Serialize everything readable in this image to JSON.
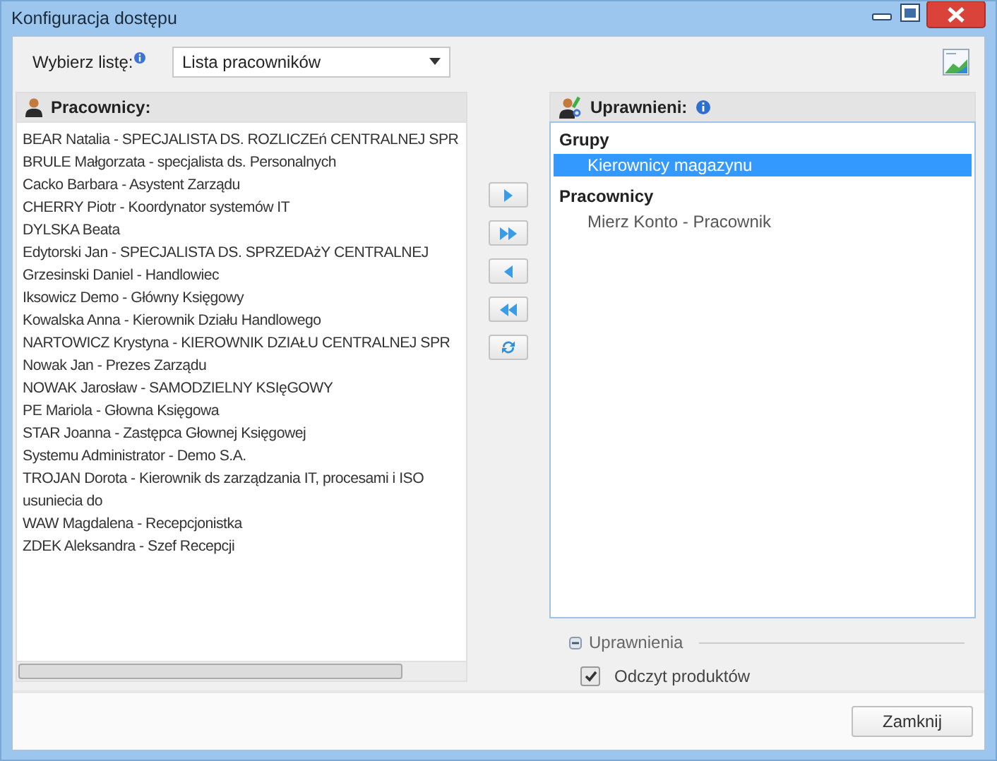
{
  "window": {
    "title": "Konfiguracja dostępu"
  },
  "list_picker": {
    "label": "Wybierz listę:",
    "value": "Lista pracowników"
  },
  "employees_panel": {
    "title": "Pracownicy:",
    "items": [
      "BEAR Natalia - SPECJALISTA DS. ROZLICZEń CENTRALNEJ SPR",
      "BRULE Małgorzata - specjalista ds. Personalnych",
      "Cacko Barbara - Asystent Zarządu",
      "CHERRY Piotr - Koordynator systemów IT",
      "DYLSKA Beata",
      "Edytorski Jan - SPECJALISTA DS. SPRZEDAżY CENTRALNEJ",
      "Grzesinski Daniel - Handlowiec",
      "Iksowicz Demo - Główny Księgowy",
      "Kowalska Anna - Kierownik Działu Handlowego",
      "NARTOWICZ Krystyna - KIEROWNIK DZIAŁU CENTRALNEJ SPR",
      "Nowak Jan - Prezes Zarządu",
      "NOWAK Jarosław - SAMODZIELNY KSIęGOWY",
      "PE Mariola - Głowna Księgowa",
      "STAR Joanna - Zastępca Głownej Księgowej",
      "Systemu Administrator - Demo S.A.",
      "TROJAN Dorota - Kierownik ds zarządzania IT, procesami i ISO\nusuniecia do",
      "WAW Magdalena - Recepcjonistka",
      "ZDEK Aleksandra - Szef Recepcji"
    ]
  },
  "transfer_buttons": [
    {
      "kind": "add"
    },
    {
      "kind": "add_all"
    },
    {
      "kind": "remove"
    },
    {
      "kind": "remove_all"
    },
    {
      "kind": "refresh"
    }
  ],
  "authorized_panel": {
    "title": "Uprawnieni:",
    "sections": [
      {
        "title": "Grupy",
        "items": [
          {
            "label": "Kierownicy magazynu",
            "selected": true
          }
        ]
      },
      {
        "title": "Pracownicy",
        "items": [
          {
            "label": "Mierz Konto - Pracownik",
            "selected": false
          }
        ]
      }
    ]
  },
  "permissions": {
    "title": "Uprawnienia",
    "expanded": true,
    "items": [
      {
        "label": "Odczyt produktów",
        "checked": true
      }
    ]
  },
  "buttons": [
    "Zamknij"
  ]
}
